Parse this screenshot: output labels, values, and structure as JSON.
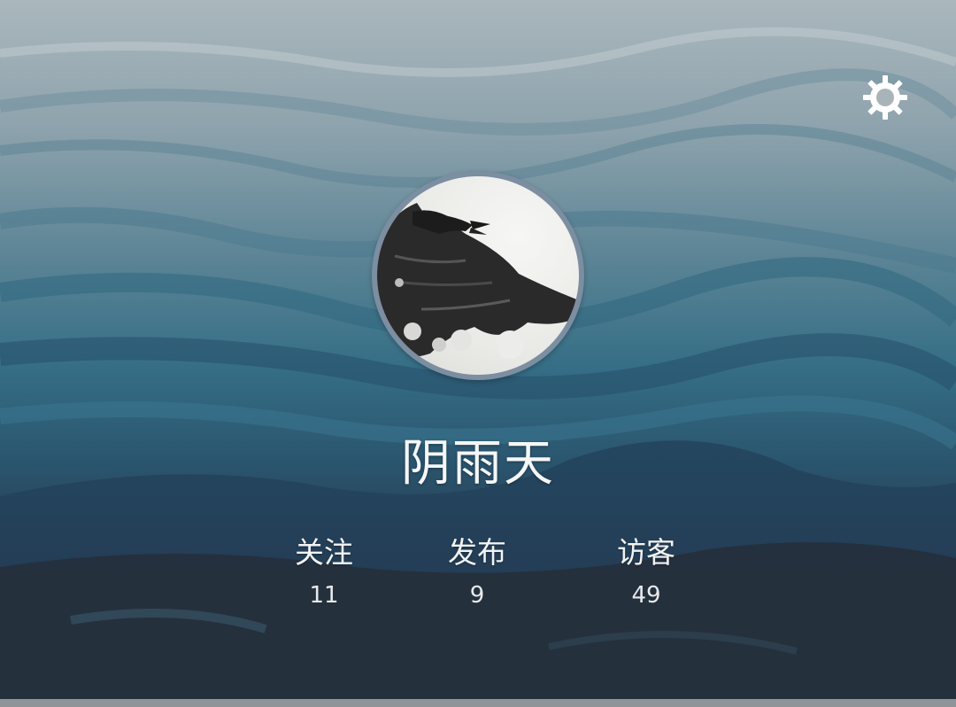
{
  "profile": {
    "username": "阴雨天"
  },
  "stats": [
    {
      "label": "关注",
      "value": "11"
    },
    {
      "label": "发布",
      "value": "9"
    },
    {
      "label": "访客",
      "value": "49"
    }
  ],
  "icons": {
    "settings": "gear-icon",
    "avatar": "crow-avatar"
  },
  "colors": {
    "text": "#f4f6f7",
    "avatar_ring": "#7c8ea1",
    "sea_light": "#aab7bd",
    "sea_mid": "#356e86",
    "sea_dark": "#2b3038"
  }
}
